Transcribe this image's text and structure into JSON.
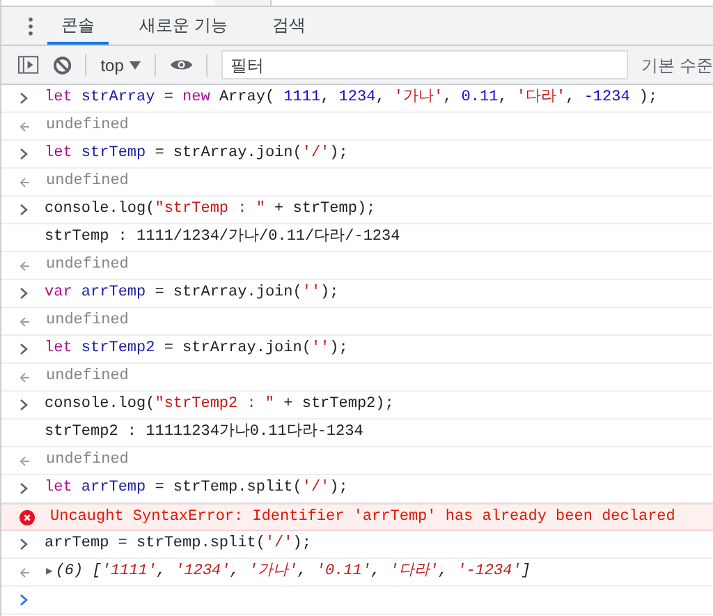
{
  "tabs": [
    {
      "label": "콘솔",
      "selected": true
    },
    {
      "label": "새로운 기능",
      "selected": false
    },
    {
      "label": "검색",
      "selected": false
    }
  ],
  "toolbar": {
    "context": "top",
    "filter": {
      "placeholder": "필터"
    },
    "levels": "기본 수준"
  },
  "entries": [
    {
      "kind": "input",
      "tokens": [
        {
          "kind": "keyword",
          "text": "let"
        },
        {
          "kind": "variable",
          "text": " strArray"
        },
        {
          "kind": "plain",
          "text": " = "
        },
        {
          "kind": "keyword",
          "text": "new"
        },
        {
          "kind": "plain",
          "text": " Array( "
        },
        {
          "kind": "number",
          "text": "1111"
        },
        {
          "kind": "plain",
          "text": ", "
        },
        {
          "kind": "number",
          "text": "1234"
        },
        {
          "kind": "plain",
          "text": ", "
        },
        {
          "kind": "string",
          "text": "'가나'"
        },
        {
          "kind": "plain",
          "text": ", "
        },
        {
          "kind": "number",
          "text": "0.11"
        },
        {
          "kind": "plain",
          "text": ", "
        },
        {
          "kind": "string",
          "text": "'다라'"
        },
        {
          "kind": "plain",
          "text": ", "
        },
        {
          "kind": "number",
          "text": "-1234"
        },
        {
          "kind": "plain",
          "text": " );"
        }
      ]
    },
    {
      "kind": "return",
      "tokens": [
        {
          "kind": "undefined",
          "text": "undefined"
        }
      ]
    },
    {
      "kind": "input",
      "tokens": [
        {
          "kind": "keyword",
          "text": "let"
        },
        {
          "kind": "variable",
          "text": " strTemp"
        },
        {
          "kind": "plain",
          "text": " = strArray.join("
        },
        {
          "kind": "string",
          "text": "'/'"
        },
        {
          "kind": "plain",
          "text": ");"
        }
      ]
    },
    {
      "kind": "return",
      "tokens": [
        {
          "kind": "undefined",
          "text": "undefined"
        }
      ]
    },
    {
      "kind": "input",
      "tokens": [
        {
          "kind": "plain",
          "text": "console.log("
        },
        {
          "kind": "string",
          "text": "\"strTemp : \""
        },
        {
          "kind": "plain",
          "text": " + strTemp);"
        }
      ]
    },
    {
      "kind": "log",
      "tokens": [
        {
          "kind": "plain",
          "text": "strTemp : 1111/1234/가나/0.11/다라/-1234"
        }
      ]
    },
    {
      "kind": "return",
      "tokens": [
        {
          "kind": "undefined",
          "text": "undefined"
        }
      ]
    },
    {
      "kind": "input",
      "tokens": [
        {
          "kind": "keyword",
          "text": "var"
        },
        {
          "kind": "variable",
          "text": " arrTemp"
        },
        {
          "kind": "plain",
          "text": " = strArray.join("
        },
        {
          "kind": "string",
          "text": "''"
        },
        {
          "kind": "plain",
          "text": ");"
        }
      ]
    },
    {
      "kind": "return",
      "tokens": [
        {
          "kind": "undefined",
          "text": "undefined"
        }
      ]
    },
    {
      "kind": "input",
      "tokens": [
        {
          "kind": "keyword",
          "text": "let"
        },
        {
          "kind": "variable",
          "text": " strTemp2"
        },
        {
          "kind": "plain",
          "text": " = strArray.join("
        },
        {
          "kind": "string",
          "text": "''"
        },
        {
          "kind": "plain",
          "text": ");"
        }
      ]
    },
    {
      "kind": "return",
      "tokens": [
        {
          "kind": "undefined",
          "text": "undefined"
        }
      ]
    },
    {
      "kind": "input",
      "tokens": [
        {
          "kind": "plain",
          "text": "console.log("
        },
        {
          "kind": "string",
          "text": "\"strTemp2 : \""
        },
        {
          "kind": "plain",
          "text": " + strTemp2);"
        }
      ]
    },
    {
      "kind": "log",
      "tokens": [
        {
          "kind": "plain",
          "text": "strTemp2 : 11111234가나0.11다라-1234"
        }
      ]
    },
    {
      "kind": "return",
      "tokens": [
        {
          "kind": "undefined",
          "text": "undefined"
        }
      ]
    },
    {
      "kind": "input",
      "tokens": [
        {
          "kind": "keyword",
          "text": "let"
        },
        {
          "kind": "variable",
          "text": " arrTemp"
        },
        {
          "kind": "plain",
          "text": " = strTemp.split("
        },
        {
          "kind": "string",
          "text": "'/'"
        },
        {
          "kind": "plain",
          "text": ");"
        }
      ]
    },
    {
      "kind": "error",
      "tokens": [
        {
          "kind": "error",
          "text": "Uncaught SyntaxError: Identifier 'arrTemp' has already been declared"
        }
      ]
    },
    {
      "kind": "input",
      "tokens": [
        {
          "kind": "plain",
          "text": "arrTemp = strTemp.split("
        },
        {
          "kind": "string",
          "text": "'/'"
        },
        {
          "kind": "plain",
          "text": ");"
        }
      ]
    },
    {
      "kind": "result",
      "expander": "▶",
      "tokens": [
        {
          "kind": "italic",
          "text": "(6) ["
        },
        {
          "kind": "italic-string",
          "text": "'1111'"
        },
        {
          "kind": "italic",
          "text": ", "
        },
        {
          "kind": "italic-string",
          "text": "'1234'"
        },
        {
          "kind": "italic",
          "text": ", "
        },
        {
          "kind": "italic-string",
          "text": "'가나'"
        },
        {
          "kind": "italic",
          "text": ", "
        },
        {
          "kind": "italic-string",
          "text": "'0.11'"
        },
        {
          "kind": "italic",
          "text": ", "
        },
        {
          "kind": "italic-string",
          "text": "'다라'"
        },
        {
          "kind": "italic",
          "text": ", "
        },
        {
          "kind": "italic-string",
          "text": "'-1234'"
        },
        {
          "kind": "italic",
          "text": "]"
        }
      ]
    },
    {
      "kind": "prompt"
    }
  ]
}
